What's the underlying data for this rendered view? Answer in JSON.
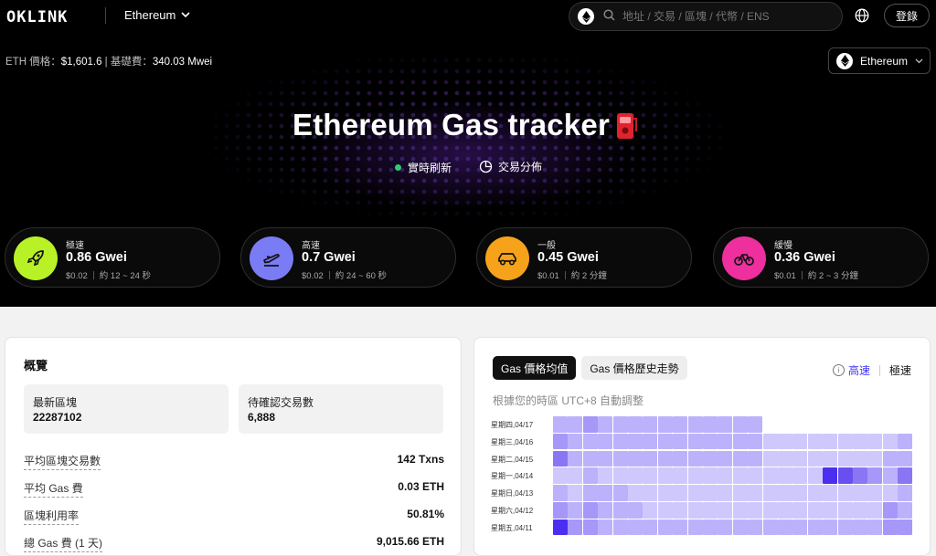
{
  "nav": {
    "logo": "OKLINK",
    "chain": "Ethereum",
    "search_placeholder": "地址 / 交易 / 區塊 / 代幣 / ENS",
    "login": "登錄"
  },
  "price_bar": {
    "eth_label": "ETH 價格：",
    "eth_price": "$1,601.6",
    "sep": "|",
    "base_label": "基礎費：",
    "base_fee": "340.03 Mwei"
  },
  "network_dropdown": "Ethereum",
  "hero": {
    "title": "Ethereum Gas tracker",
    "refresh": "實時刷新",
    "distribution": "交易分佈"
  },
  "speeds": [
    {
      "label": "極速",
      "gwei": "0.86 Gwei",
      "usd": "$0.02",
      "time": "約 12 ~ 24 秒",
      "color": "#b8f226",
      "icon": "rocket-icon"
    },
    {
      "label": "高速",
      "gwei": "0.7 Gwei",
      "usd": "$0.02",
      "time": "約 24 ~ 60 秒",
      "color": "#7a7cf5",
      "icon": "plane-icon"
    },
    {
      "label": "一般",
      "gwei": "0.45 Gwei",
      "usd": "$0.01",
      "time": "約 2 分鐘",
      "color": "#f7a21b",
      "icon": "car-icon"
    },
    {
      "label": "緩慢",
      "gwei": "0.36 Gwei",
      "usd": "$0.01",
      "time": "約 2 ~ 3 分鐘",
      "color": "#ee2f9e",
      "icon": "bicycle-icon"
    }
  ],
  "overview": {
    "title": "概覽",
    "latest_block_label": "最新區塊",
    "latest_block": "22287102",
    "pending_label": "待確認交易數",
    "pending": "6,888",
    "rows": [
      {
        "label": "平均區塊交易數",
        "value": "142 Txns"
      },
      {
        "label": "平均 Gas 費",
        "value": "0.03 ETH"
      },
      {
        "label": "區塊利用率",
        "value": "50.81%"
      },
      {
        "label": "總 Gas 費 (1 天)",
        "value": "9,015.66 ETH"
      }
    ]
  },
  "heatmap": {
    "tab_active": "Gas 價格均值",
    "tab_inactive": "Gas 價格歷史走勢",
    "legend_fast": "高速",
    "legend_fastest": "極速",
    "timezone_note": "根據您的時區 UTC+8 自動調整",
    "days": [
      "星期四,04/17",
      "星期三,04/16",
      "星期二,04/15",
      "星期一,04/14",
      "星期日,04/13",
      "星期六,04/12",
      "星期五,04/11"
    ],
    "levels": [
      [
        2,
        2,
        3,
        2,
        2,
        2,
        2,
        2,
        2,
        2,
        2,
        2,
        2,
        2,
        -1,
        -1,
        -1,
        -1,
        -1,
        -1,
        -1,
        -1,
        -1,
        -1
      ],
      [
        3,
        2,
        2,
        2,
        2,
        2,
        2,
        2,
        2,
        2,
        2,
        2,
        2,
        2,
        1,
        1,
        1,
        1,
        1,
        1,
        1,
        1,
        1,
        2
      ],
      [
        4,
        2,
        2,
        2,
        2,
        2,
        2,
        2,
        2,
        2,
        2,
        2,
        2,
        2,
        1,
        1,
        1,
        1,
        1,
        1,
        1,
        1,
        2,
        2
      ],
      [
        1,
        1,
        2,
        1,
        1,
        1,
        1,
        1,
        1,
        1,
        1,
        1,
        1,
        1,
        1,
        1,
        1,
        1,
        6,
        5,
        4,
        3,
        2,
        4
      ],
      [
        2,
        1,
        2,
        2,
        2,
        1,
        1,
        1,
        1,
        1,
        1,
        1,
        1,
        1,
        1,
        1,
        1,
        1,
        1,
        1,
        1,
        1,
        1,
        2
      ],
      [
        3,
        2,
        3,
        2,
        2,
        2,
        1,
        1,
        1,
        1,
        1,
        1,
        1,
        1,
        1,
        1,
        1,
        1,
        1,
        1,
        1,
        1,
        3,
        2
      ],
      [
        6,
        3,
        3,
        2,
        2,
        2,
        2,
        2,
        2,
        2,
        2,
        2,
        2,
        2,
        2,
        2,
        2,
        2,
        2,
        2,
        2,
        2,
        3,
        3
      ]
    ]
  }
}
